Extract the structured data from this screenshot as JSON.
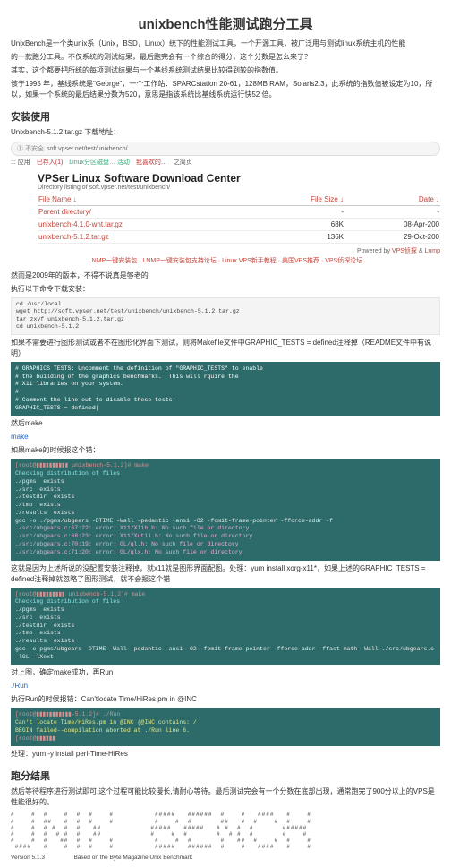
{
  "title": "unixbench性能测试跑分工具",
  "intro1": "UnixBench是一个类unix系（Unix，BSD，Linux）统下的性能测试工具，一个开源工具，被广泛用与测试linux系统主机的性能",
  "intro2": "的一款跑分工具。不仅系统的测试结果，最后跑完会有一个综合的得分，这个分数是怎么来了？",
  "intro3": "其实，这个都要把所统的每项测试结果与一个基线系统测试结果比较得到较的指数值。",
  "intro4": "该于1995 年，基线系统是\"George\"，一个工作站：SPARCstation 20-61，128MB RAM，Solaris2.3，此系统的指数值被设定为10，所以，如果一个系统的最后结果分数为520，意思是指该系统比基线系统运行快52 倍。",
  "install_heading": "安装使用",
  "download_line": "Unixbench-5.1.2.tar.gz 下载地址：",
  "addr_warn": "① 不安全",
  "addr_url": "soft.vpser.net/test/unixbench/",
  "tabs": {
    "apps": "::: 应用",
    "done": "已存入(1)",
    "hint": "Linux分区磁盘… 活动",
    "love": "我喜欢的…",
    "blank": "之简页"
  },
  "dl_center_title": "VPSer Linux Software Download Center",
  "dl_center_sub": "Directory listing of soft.vpser.net/test/unixbench/",
  "table": {
    "headers": {
      "name": "File Name ↓",
      "size": "File Size ↓",
      "date": "Date ↓"
    },
    "rows": [
      {
        "name": "Parent directory/",
        "size": "-",
        "date": "-"
      },
      {
        "name": "unixbench-4.1.0-wht.tar.gz",
        "size": "68K",
        "date": "08-Apr-200"
      },
      {
        "name": "unixbench-5.1.2.tar.gz",
        "size": "136K",
        "date": "29-Oct-200"
      }
    ]
  },
  "powered": {
    "prefix": "Powered by ",
    "a1": "VPS侦探",
    "amp": " & ",
    "a2": "Lnmp"
  },
  "links_line": "LNMP一键安装包 · LNMP一键安装包支持论坛 · Linux VPS新手教程 · 美国VPS推荐 · VPS侦探论坛",
  "note_old": "然而是2009年的版本，不得不说真是够老的",
  "cmd_intro": "执行以下命令下载安装：",
  "cmd_block": "cd /usr/local\nwget http://soft.vpser.net/test/unixbench/unixbench-5.1.2.tar.gz\ntar zxvf unixbench-5.1.2.tar.gz\ncd unixbench-5.1.2",
  "graphic_note": "如果不需要进行图形测试或者不在图形化界面下测试，则将Makefile文件中GRAPHIC_TESTS = defined注释掉（README文件中有说明）",
  "term1": "# GRAPHICS TESTS: Uncomment the definition of \"GRAPHIC_TESTS\" to enable\n# the building of the graphics benchmarks.  This will rquire the\n# X11 libraries on your system.\n#\n# Comment the line out to disable these tests.\nGRAPHIC_TESTS = defined|",
  "then_make": "然后make",
  "make_cmd": "make",
  "make_hint": "如果make的时候报这个错：",
  "term2_lines": {
    "l1": "[root@▮▮▮▮▮▮▮▮▮▮ unixbench-5.1.2]# make",
    "l2": "Checking distribution of files",
    "l3": "./pgms  exists",
    "l4": "./src  exists",
    "l5": "./testdir  exists",
    "l6": "./tmp  exists",
    "l7": "./results  exists",
    "l8": "gcc -o ./pgms/ubgears -DTIME -Wall -pedantic -ansi -O2 -fomit-frame-pointer -fforce-addr -f",
    "l9": "./src/ubgears.c:67:22: error: X11/Xlib.h: No such file or directory",
    "l10": "./src/ubgears.c:68:23: error: X11/Xutil.h: No such file or directory",
    "l11": "./src/ubgears.c:70:19: error: GL/gl.h: No such file or directory",
    "l12": "./src/ubgears.c:71:20: error: GL/glx.h: No such file or directory"
  },
  "term2_note": "这就是因为上述所说的没配置安装注释掉，就x11就是图形界面配图。处理：yum install xorg-x11*，如果上述的GRAPHIC_TESTS = defined注释掉就忽略了图形测试，就不会报这个错",
  "term3_lines": {
    "l1": "[root@▮▮▮▮▮▮▮▮▮ unixbench-5.1.2]# make",
    "l2": "Checking distribution of files",
    "l3": "./pgms  exists",
    "l4": "./src  exists",
    "l5": "./testdir  exists",
    "l6": "./tmp  exists",
    "l7": "./results  exists",
    "l8": "gcc -o pgms/ubgears -DTIME -Wall -pedantic -ansi -O2 -fomit-frame-pointer -fforce-addr -ffast-math -Wall ./src/ubgears.c -lGL -lXext"
  },
  "after_make": "对上图，确定make成功，再Run",
  "run_cmd": "./Run",
  "run_err_intro": "执行Run的时候报错：Can'tlocate Time/HiRes.pm in @INC",
  "term4_lines": {
    "l1": "[root@▮▮▮▮▮▮▮▮▮▮▮-5.1.2]# ./Run",
    "l2": "Can't locate Time/HiRes.pm in @INC (@INC contains: /",
    "l3": "BEGIN failed--compilation aborted at ./Run line 6.",
    "l4": "[root@▮▮▮▮▮▮"
  },
  "fix_line": "处理：yum -y install perl-Time-HiRes",
  "result_heading": "跑分结果",
  "result_intro": "然后等待程序进行测试即可,这个过程可能比较漫长,请耐心等待。最后测试完会有一个分数在底部出现，通常跑完了900分以上的VPS是性能很好的。",
  "ascii": "#    #  #    #  #  #    #          #####   ######  #    #   ####   #    #\n#    #  ##   #  #  #    #          #    #  #       ##   #  #    #  #    #\n#    #  # #  #  #   ##            #####   #####   # #  #  #       ######\n#    #  #  # #  #   ##            #    #  #       #  # #  #       #    #\n#    #  #   ##  #  #    #          #    #  #       #   ##  #    #  #    #\n ####   #    #  #  #    #          #####   ######  #    #   ####   #    #",
  "ver": "Version 5.1.3",
  "based": "Based on the Byte Magazine Unix Benchmark"
}
